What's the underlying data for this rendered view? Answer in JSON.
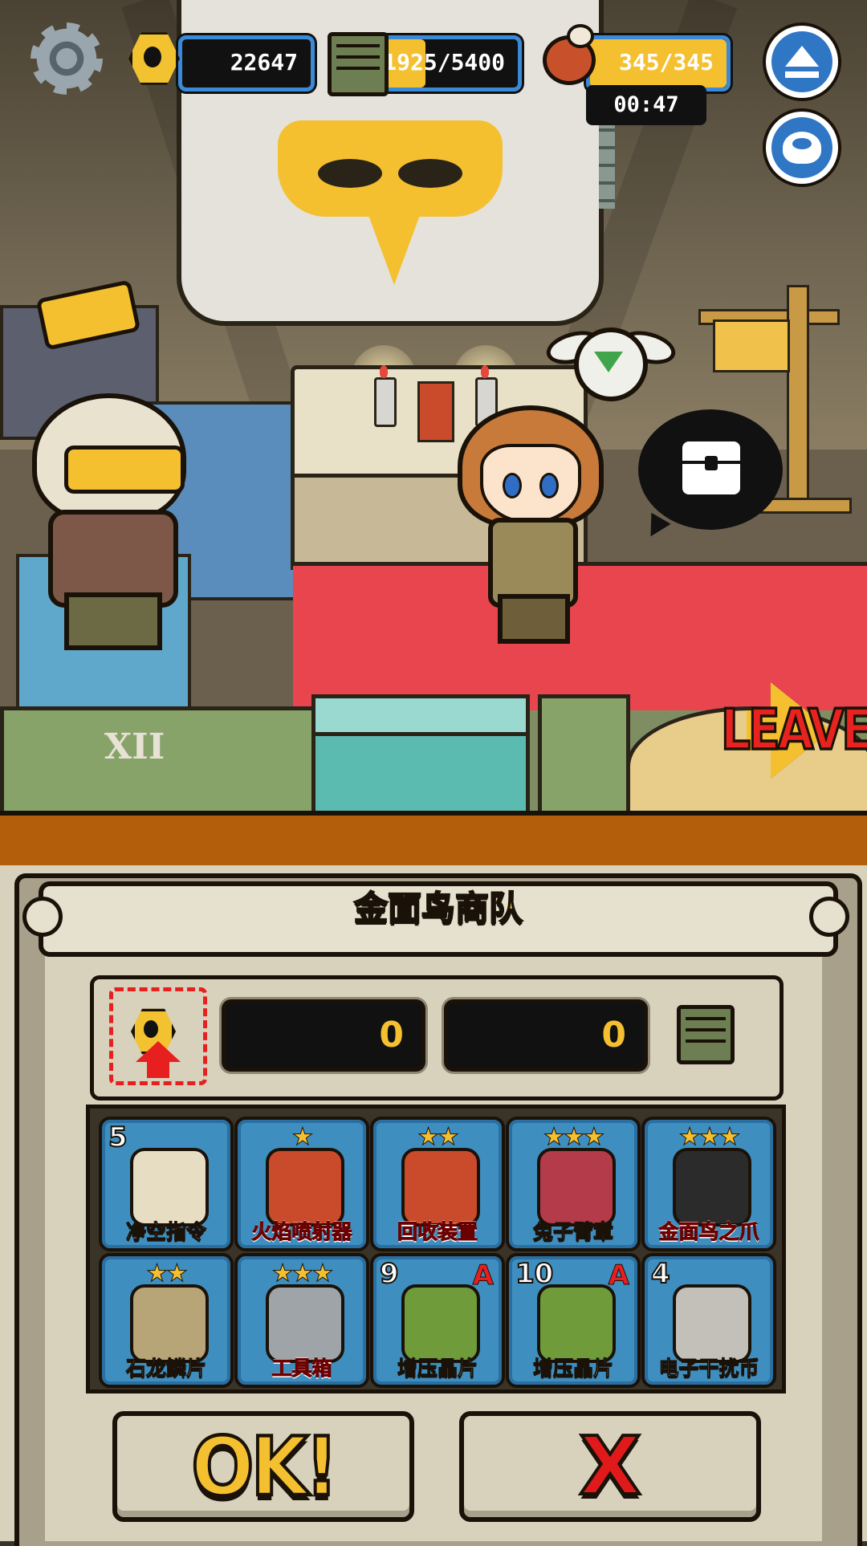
{
  "hud": {
    "bolts": "22647",
    "supplies": "1925/5400",
    "supplies_fill": 0.36,
    "food": "345/345",
    "food_fill": 1.0,
    "timer": "00:47"
  },
  "scene": {
    "leave_label": "LEAVE",
    "crate_mark": "XII"
  },
  "shop": {
    "title": "金面鸟商队",
    "bolt_amount": "0",
    "supply_amount": "0",
    "items": [
      {
        "name": "净空指令",
        "count": "5",
        "stars": "",
        "badge": "",
        "red": false
      },
      {
        "name": "火焰喷射器",
        "count": "",
        "stars": "★",
        "badge": "",
        "red": true
      },
      {
        "name": "回收装置",
        "count": "",
        "stars": "★★",
        "badge": "",
        "red": true
      },
      {
        "name": "兔子臂章",
        "count": "",
        "stars": "★★★",
        "badge": "",
        "red": false
      },
      {
        "name": "金面鸟之爪",
        "count": "",
        "stars": "★★★",
        "badge": "",
        "red": true
      },
      {
        "name": "石龙鳞片",
        "count": "",
        "stars": "★★",
        "badge": "",
        "red": false
      },
      {
        "name": "工具箱",
        "count": "",
        "stars": "★★★",
        "badge": "",
        "red": true
      },
      {
        "name": "增压晶片",
        "count": "9",
        "stars": "",
        "badge": "A",
        "red": false
      },
      {
        "name": "增压晶片",
        "count": "10",
        "stars": "",
        "badge": "A",
        "red": false
      },
      {
        "name": "电子干扰币",
        "count": "4",
        "stars": "",
        "badge": "",
        "red": false
      }
    ]
  },
  "buttons": {
    "ok_label": "OK!",
    "cancel_label": "X"
  },
  "colors": {
    "accent_yellow": "#f5c030",
    "warning_red": "#e81f1f",
    "item_blue": "#3f8ec0",
    "hud_blue": "#3b8ad8",
    "band_orange": "#b25e0a"
  }
}
